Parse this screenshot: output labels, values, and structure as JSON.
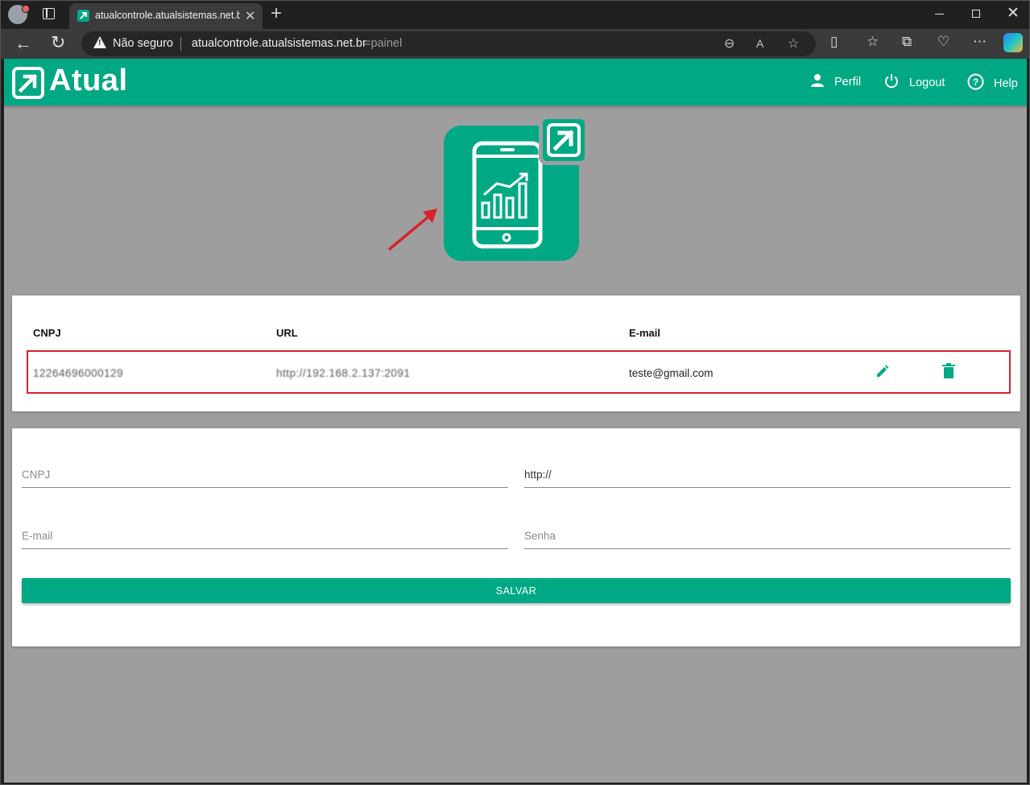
{
  "browser": {
    "tab_title": "atualcontrole.atualsistemas.net.br",
    "new_tab_label": "+",
    "security_label": "Não seguro",
    "url_host": "atualcontrole.atualsistemas.net.br",
    "url_rest": "=painel"
  },
  "app": {
    "logo_text": "Atual",
    "brand_color": "#00a884",
    "nav": [
      {
        "label": "Perfil",
        "icon": "person-icon"
      },
      {
        "label": "Logout",
        "icon": "power-icon"
      },
      {
        "label": "Help",
        "icon": "help-icon"
      }
    ]
  },
  "table": {
    "headers": [
      "CNPJ",
      "URL",
      "E-mail"
    ],
    "rows": [
      {
        "cnpj": "12264696000129",
        "url": "http://192.168.2.137:2091",
        "email": "teste@gmail.com"
      }
    ]
  },
  "form": {
    "cnpj_placeholder": "CNPJ",
    "url_value": "http://",
    "email_placeholder": "E-mail",
    "senha_placeholder": "Senha",
    "save_label": "SALVAR"
  }
}
